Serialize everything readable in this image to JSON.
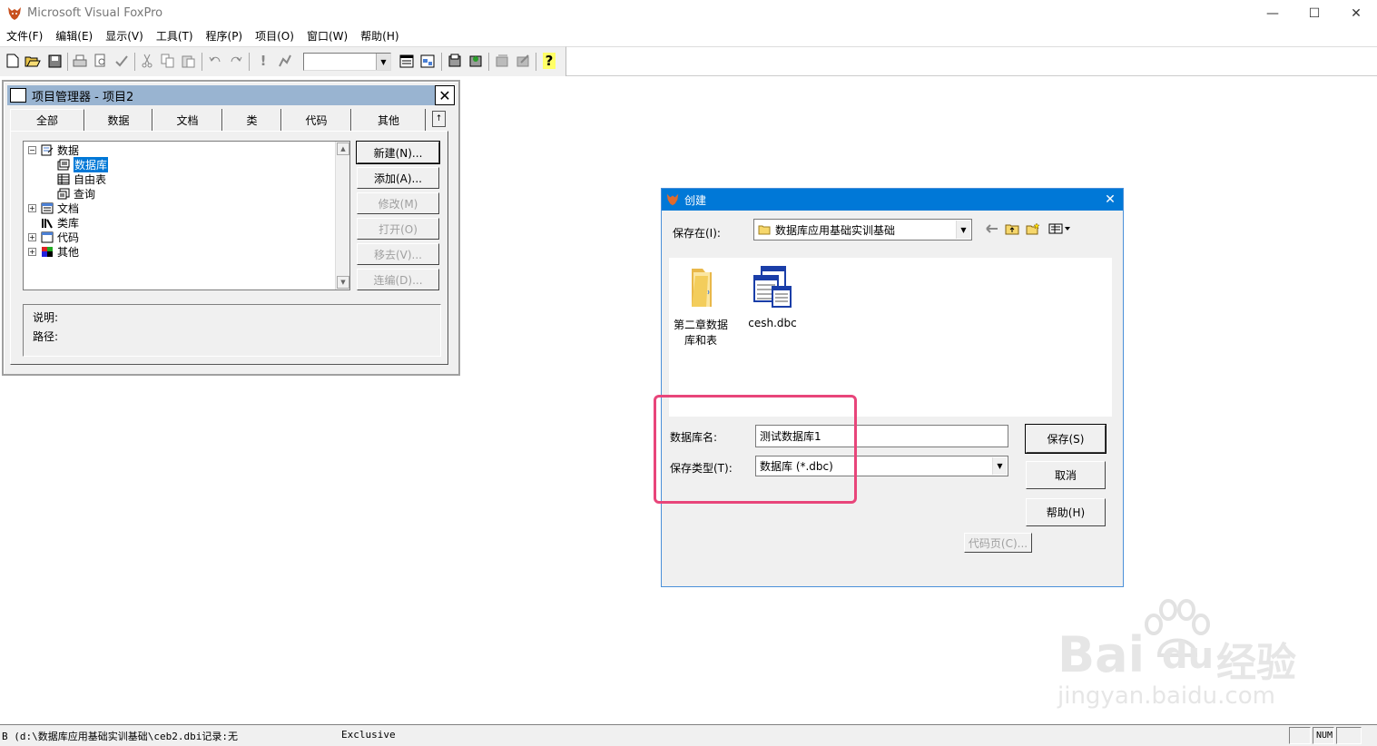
{
  "app": {
    "title": "Microsoft Visual FoxPro",
    "minimize": "—",
    "maximize": "☐",
    "close": "✕"
  },
  "menu": [
    "文件(F)",
    "编辑(E)",
    "显示(V)",
    "工具(T)",
    "程序(P)",
    "项目(O)",
    "窗口(W)",
    "帮助(H)"
  ],
  "toolbar": {
    "combo_value": "",
    "help_glyph": "?",
    "run_glyph": "!"
  },
  "project_manager": {
    "title": "项目管理器 - 项目2",
    "close": "✕",
    "tabs": [
      "全部",
      "数据",
      "文档",
      "类",
      "代码",
      "其他"
    ],
    "tab_scroll": "↑",
    "tree": [
      {
        "label": "数据",
        "expander": "−",
        "level": 0
      },
      {
        "label": "数据库",
        "expander": "",
        "level": 1,
        "selected": true
      },
      {
        "label": "自由表",
        "expander": "",
        "level": 1
      },
      {
        "label": "查询",
        "expander": "",
        "level": 1
      },
      {
        "label": "文档",
        "expander": "+",
        "level": 0
      },
      {
        "label": "类库",
        "expander": "",
        "level": 0
      },
      {
        "label": "代码",
        "expander": "+",
        "level": 0
      },
      {
        "label": "其他",
        "expander": "+",
        "level": 0
      }
    ],
    "buttons": [
      {
        "label": "新建(N)...",
        "enabled": true
      },
      {
        "label": "添加(A)...",
        "enabled": true
      },
      {
        "label": "修改(M)",
        "enabled": false
      },
      {
        "label": "打开(O)",
        "enabled": false
      },
      {
        "label": "移去(V)...",
        "enabled": false
      },
      {
        "label": "连编(D)...",
        "enabled": false
      }
    ],
    "info": {
      "description_label": "说明:",
      "path_label": "路径:"
    }
  },
  "dialog": {
    "title": "创建",
    "close": "✕",
    "save_in_label": "保存在(I):",
    "save_in_value": "数据库应用基础实训基础",
    "files": [
      {
        "name": "第二章数据库和表",
        "type": "folder"
      },
      {
        "name": "cesh.dbc",
        "type": "database"
      }
    ],
    "db_name_label": "数据库名:",
    "db_name_value": "测试数据库1",
    "save_type_label": "保存类型(T):",
    "save_type_value": "数据库 (*.dbc)",
    "buttons": {
      "save": "保存(S)",
      "cancel": "取消",
      "help": "帮助(H)",
      "codepage": "代码页(C)..."
    },
    "highlight_color": "#e8457a"
  },
  "statusbar": {
    "text": "B (d:\\数据库应用基础实训基础\\ceb2.dbi记录:无",
    "mode": "Exclusive",
    "num": "NUM"
  },
  "watermark": {
    "brand": "Bai",
    "brand2": "du",
    "cn": "经验",
    "url": "jingyan.baidu.com"
  },
  "colors": {
    "dialog_title": "#0078d7",
    "pm_title": "#99b4d1",
    "selection": "#0078d7"
  }
}
